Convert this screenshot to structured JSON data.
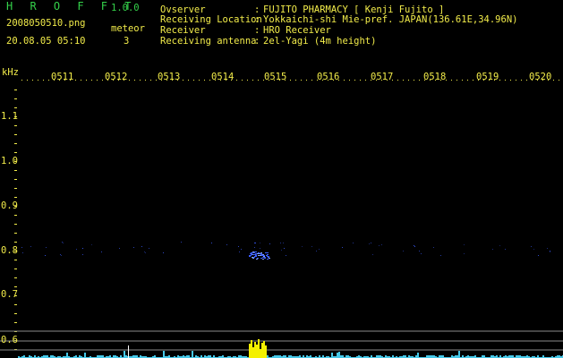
{
  "header": {
    "app_title": "H R O F F T",
    "app_version": "1.0.0",
    "filename": "2008050510.png",
    "datetime": "20.08.05 05:10",
    "meteor_label": "meteor",
    "meteor_count": "3"
  },
  "info": {
    "rows": [
      {
        "label": "Ovserver",
        "value": "FUJITO PHARMACY [ Kenji Fujito ]"
      },
      {
        "label": "Receiving Location",
        "value": "Yokkaichi-shi Mie-pref. JAPAN(136.61E,34.96N)"
      },
      {
        "label": "Receiver",
        "value": "HRO Receiver"
      },
      {
        "label": "Receiving antenna",
        "value": "2el-Yagi (4m height)"
      }
    ],
    "colon": ":"
  },
  "axes": {
    "unit": "kHz",
    "time_ticks": [
      "0511",
      "0512",
      "0513",
      "0514",
      "0515",
      "0516",
      "0517",
      "0518",
      "0519",
      "0520"
    ],
    "freq_ticks": [
      "1.1",
      "1.0",
      "0.9",
      "0.8",
      "0.7",
      "0.6"
    ]
  },
  "colors": {
    "background": "#000000",
    "title_green": "#34d14a",
    "axis_yellow": "#f2ec4a",
    "signal_blue": "#3a5cff",
    "meteor_yellow": "#f4f000",
    "baseline_cyan": "#46c8e8"
  }
}
